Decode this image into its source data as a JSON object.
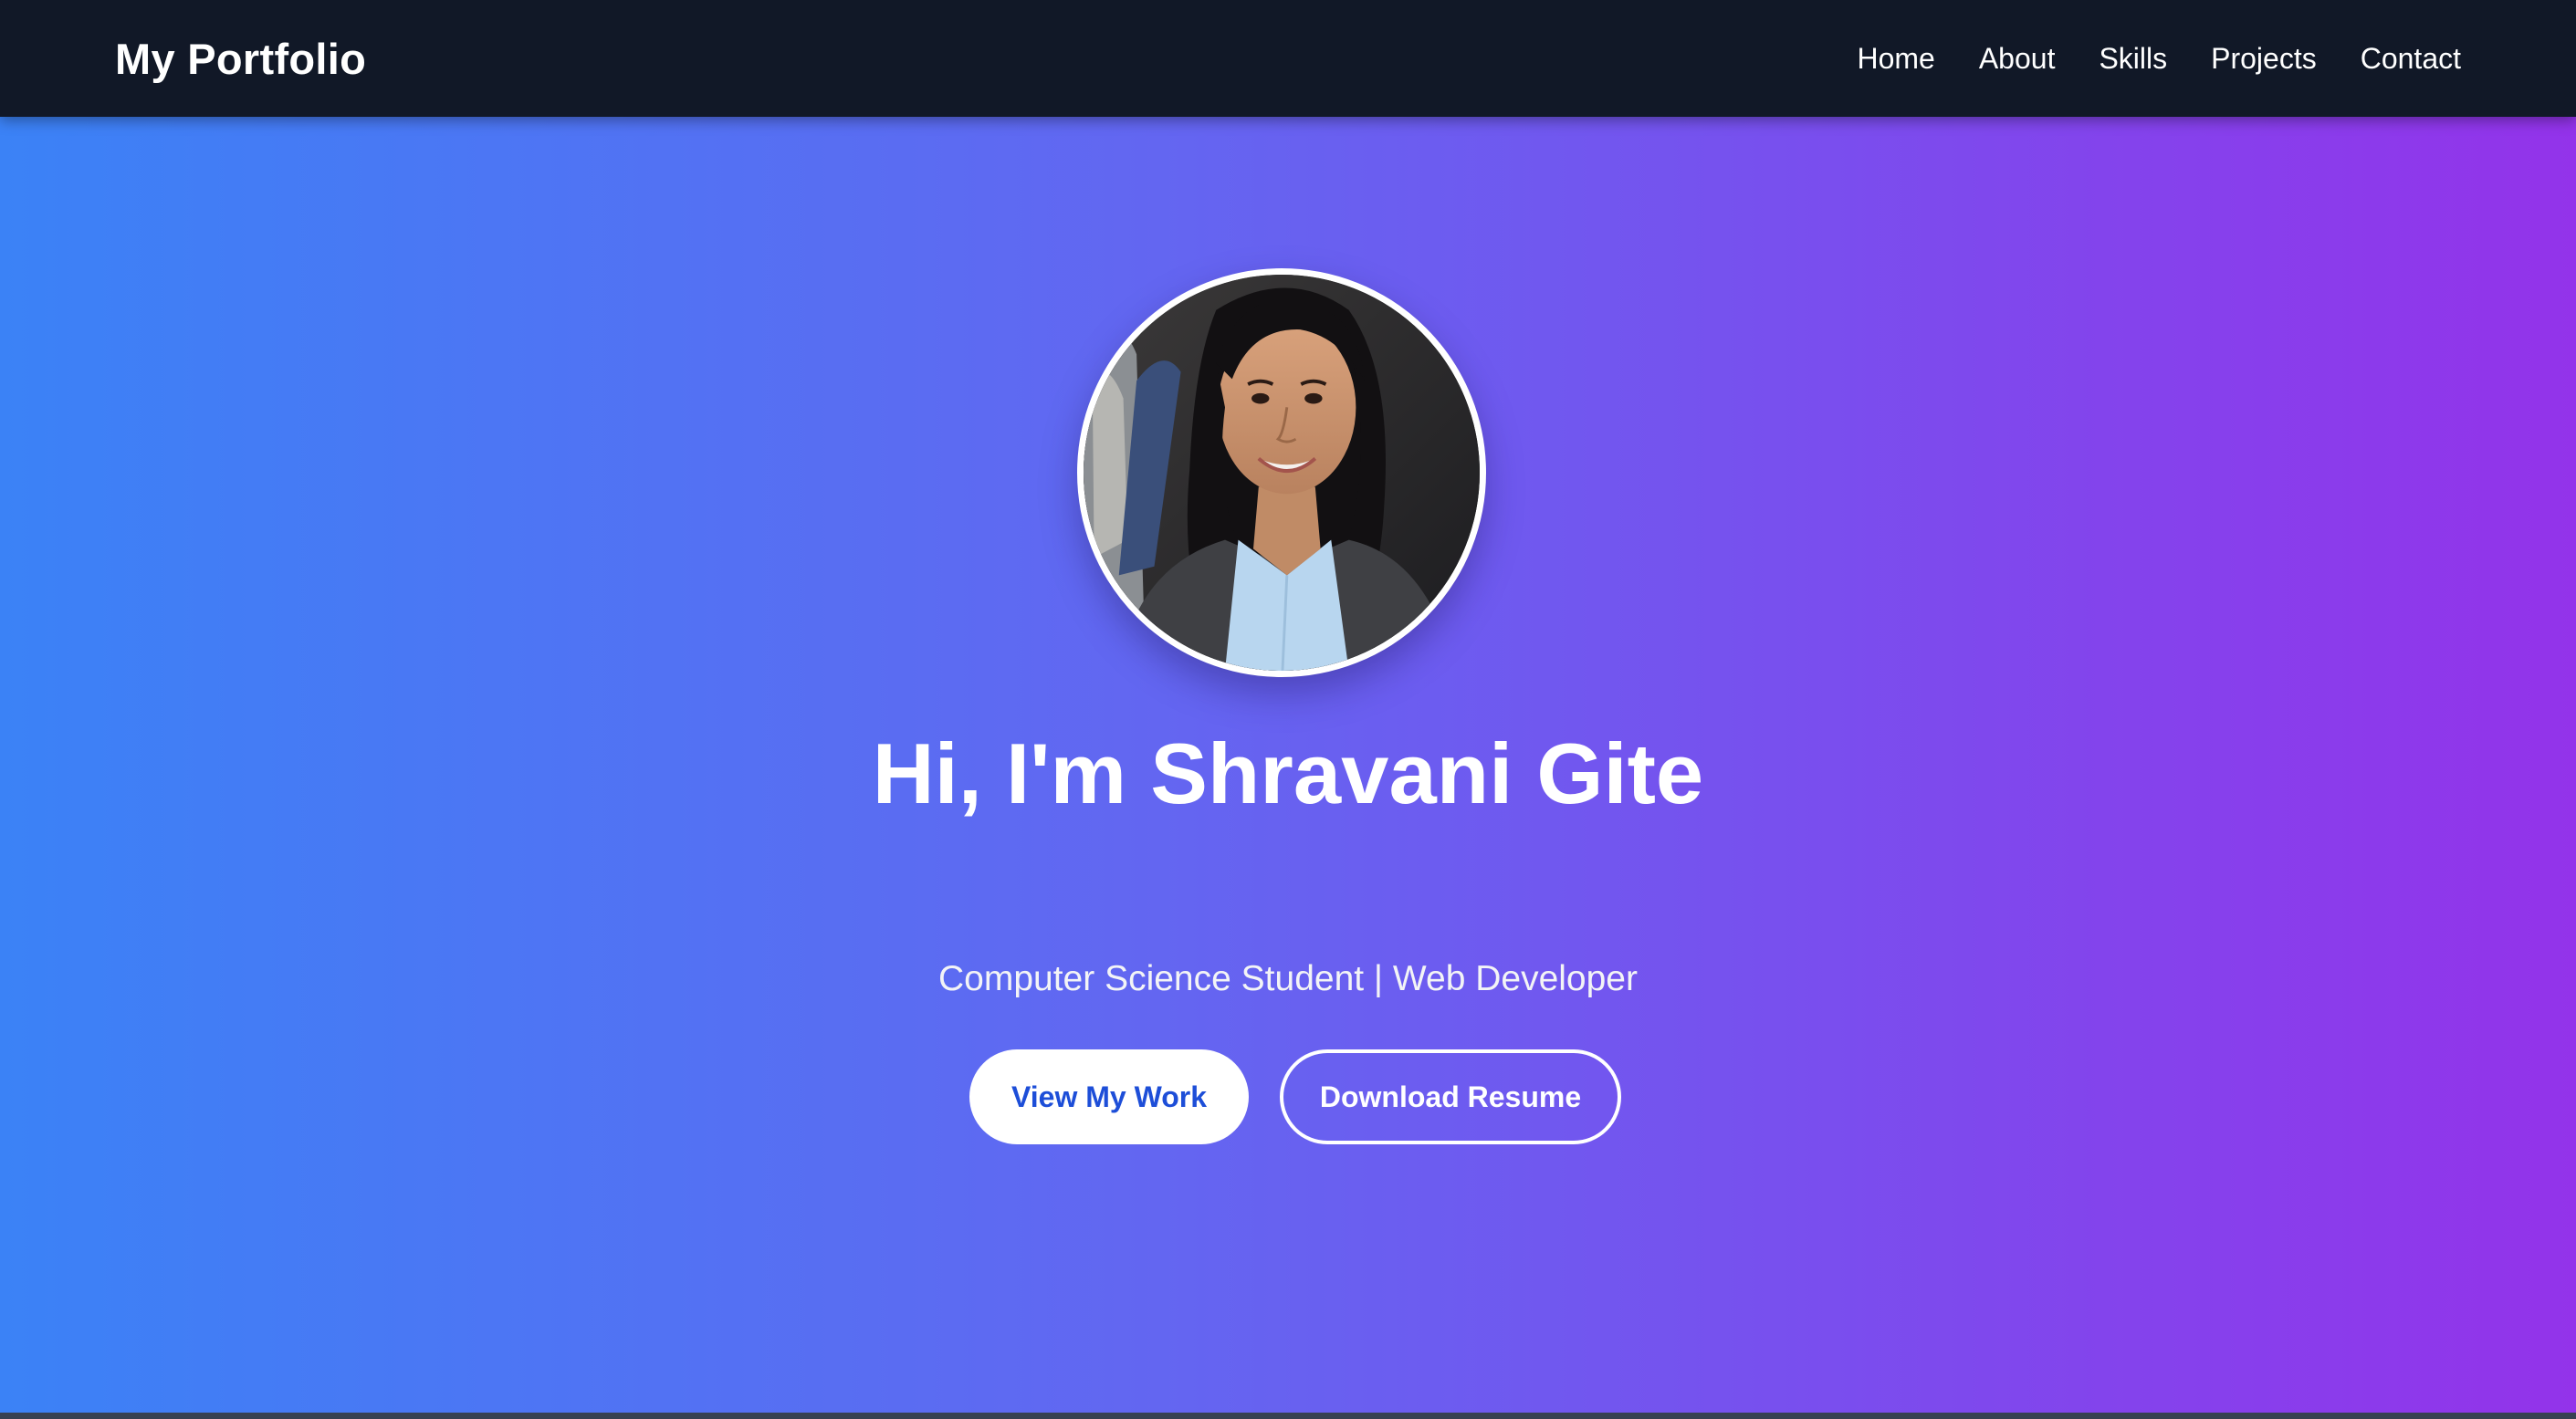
{
  "navbar": {
    "brand": "My Portfolio",
    "links": [
      "Home",
      "About",
      "Skills",
      "Projects",
      "Contact"
    ]
  },
  "hero": {
    "title": "Hi, I'm Shravani Gite",
    "subtitle": "Computer Science Student | Web Developer",
    "buttons": {
      "view_work": "View My Work",
      "download_resume": "Download Resume"
    }
  },
  "colors": {
    "navbar_bg": "#111827",
    "gradient_start": "#3b82f6",
    "gradient_mid": "#6366f1",
    "gradient_end": "#9333ea",
    "primary_button_text": "#1d4ed8"
  }
}
